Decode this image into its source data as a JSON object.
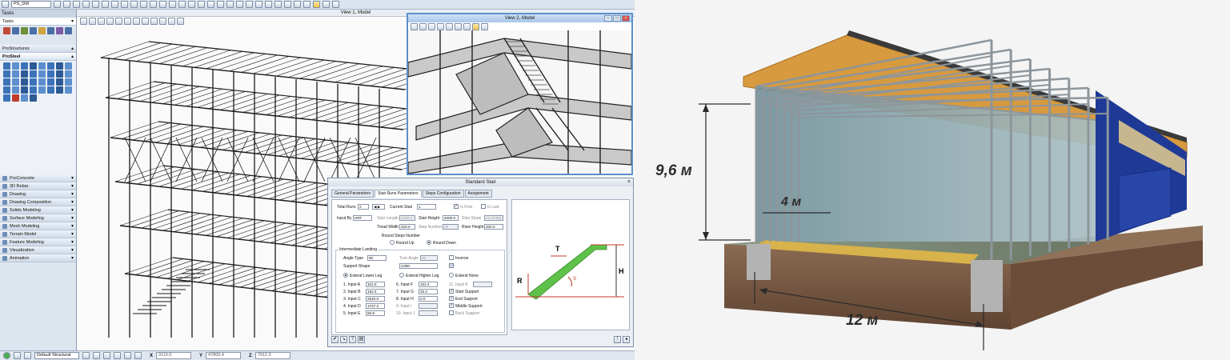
{
  "toolbar": {
    "workset": "PS_DM"
  },
  "sidebar": {
    "tasks_title": "Tasks",
    "tasks_select": "Tasks",
    "prostructures_label": "ProStructures",
    "prosteel_label": "ProSteel",
    "sections": [
      "ProConcrete",
      "3D Rebar",
      "Drawing",
      "Drawing Composition",
      "Solids Modeling",
      "Surface Modeling",
      "Mesh Modeling",
      "Terrain Model",
      "Feature Modeling",
      "Visualization",
      "Animation"
    ]
  },
  "view1": {
    "title": "View 1, Model"
  },
  "view2": {
    "title": "View 2, Model"
  },
  "dialog": {
    "title": "Standard Stair",
    "tabs": [
      "General Parameters",
      "Stair Runs Parameters",
      "Steps Configuration",
      "Assignment"
    ],
    "total_runs_label": "Total Runs",
    "total_runs_value": "2",
    "current_stair_label": "Current Stair",
    "current_stair_value": "1",
    "is_first_label": "Is First",
    "is_last_label": "Is Last",
    "input_by_label": "Input By",
    "input_by_value": "HRT",
    "stair_length_label": "Stair Length",
    "stair_length_value": "4330.0",
    "stair_height_label": "Stair Height",
    "stair_height_value": "4000.0",
    "stair_slope_label": "Stair Slope",
    "stair_slope_value": "42.27369",
    "tread_width_label": "Tread Width",
    "tread_width_value": "220.0",
    "step_number_label": "Step Number",
    "step_number_value": "19",
    "riser_height_label": "Riser Height",
    "riser_height_value": "200.0",
    "round_steps_label": "Round Steps Number",
    "round_up": "Round Up",
    "round_down": "Round Down",
    "landing_title": "Intermediate Landing",
    "angle_type_label": "Angle Type",
    "angle_type_value": "90",
    "turn_angle_label": "Turn Angle",
    "turn_angle_value": "90",
    "inverse_label": "Inverse",
    "support_shape_label": "Support Shape",
    "support_shape_value": "U300",
    "extend_lower": "Extend Lower Leg",
    "extend_higher": "Extend Higher Leg",
    "extend_none": "Extend None",
    "inputs_left": [
      {
        "label": "1. Input A",
        "value": "101.6"
      },
      {
        "label": "2. Input B",
        "value": "152.4"
      },
      {
        "label": "3. Input C",
        "value": "2540.0"
      },
      {
        "label": "4. Input D",
        "value": "1727.2"
      },
      {
        "label": "5. Input E",
        "value": "50.8"
      }
    ],
    "inputs_mid": [
      {
        "label": "6. Input F",
        "value": "152.4"
      },
      {
        "label": "7. Input G",
        "value": "25.4"
      },
      {
        "label": "8. Input H",
        "value": "0.0"
      },
      {
        "label": "9. Input I",
        "value": ""
      },
      {
        "label": "10. Input J",
        "value": ""
      }
    ],
    "input_k_label": "11. Input K",
    "supports": [
      {
        "label": "Start Support",
        "checked": true
      },
      {
        "label": "End Support",
        "checked": true
      },
      {
        "label": "Middle Support",
        "checked": true
      },
      {
        "label": "Back Support",
        "checked": false
      }
    ],
    "diagram": {
      "t": "T",
      "r": "R",
      "h": "H",
      "s": "S"
    }
  },
  "statusbar": {
    "level": "Default Structural",
    "x_label": "X",
    "x_value": "3110.0",
    "y_label": "Y",
    "y_value": "47800.4",
    "z_label": "Z",
    "z_value": "7912.3"
  },
  "render": {
    "height_dim": "9,6 м",
    "bay_dim": "4 м",
    "span_dim": "12 м"
  },
  "colors": {
    "accent": "#5c8fcd",
    "wall_blue": "#1f3a96",
    "glass": "#7f9ea6",
    "soil": "#7a5b43",
    "roof_orange": "#d79a3f"
  }
}
